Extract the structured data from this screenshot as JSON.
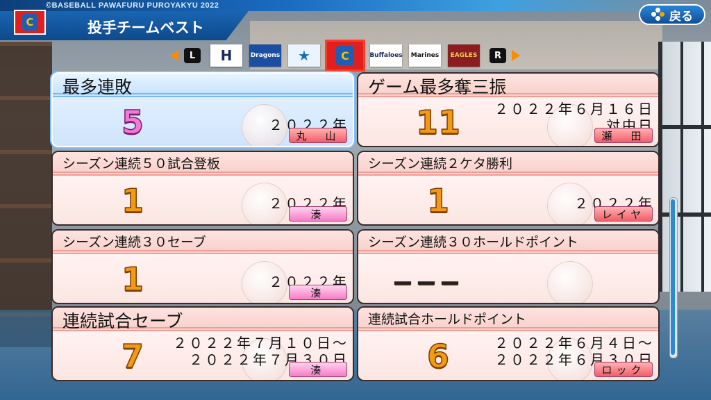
{
  "header": {
    "copyright": "©BASEBALL PAWAFURU PUROYAKYU 2022",
    "title": "投手チームベスト",
    "team_letter": "C",
    "back_label": "戻る"
  },
  "team_selector": {
    "left_key": "L",
    "right_key": "R",
    "teams": [
      {
        "mark": "H",
        "bg": "#ffffff",
        "fg": "#1a2a5a"
      },
      {
        "mark": "Dragons",
        "bg": "#1b4da0",
        "fg": "#ffffff"
      },
      {
        "mark": "★",
        "bg": "#eaf4ff",
        "fg": "#1a6bc0"
      },
      {
        "mark": "C",
        "bg": "#e0201f",
        "fg": "#f4c300",
        "selected": true
      },
      {
        "mark": "Buffaloes",
        "bg": "#ffffff",
        "fg": "#1a2a5a"
      },
      {
        "mark": "Marines",
        "bg": "#ffffff",
        "fg": "#111111"
      },
      {
        "mark": "EAGLES",
        "bg": "#8b1c22",
        "fg": "#f2c94c"
      }
    ]
  },
  "records": [
    {
      "label": "最多連敗",
      "value": "5",
      "dates": [
        "２０２２年"
      ],
      "player": "丸　山",
      "player_style": "red",
      "value_style": "pink",
      "style": "blue",
      "big": true
    },
    {
      "label": "ゲーム最多奪三振",
      "value": "11",
      "dates": [
        "２０２２年６月１６日",
        "対中日"
      ],
      "player": "瀬　田",
      "player_style": "red",
      "value_style": "orange",
      "style": "pink",
      "big": true
    },
    {
      "label": "シーズン連続５０試合登板",
      "value": "1",
      "dates": [
        "２０２２年"
      ],
      "player": "湊",
      "player_style": "pink",
      "value_style": "orange",
      "style": "pink"
    },
    {
      "label": "シーズン連続２ケタ勝利",
      "value": "1",
      "dates": [
        "２０２２年"
      ],
      "player": "レイヤ",
      "player_style": "red",
      "value_style": "orange",
      "style": "pink"
    },
    {
      "label": "シーズン連続３０セーブ",
      "value": "1",
      "dates": [
        "２０２２年"
      ],
      "player": "湊",
      "player_style": "pink",
      "value_style": "orange",
      "style": "pink"
    },
    {
      "label": "シーズン連続３０ホールドポイント",
      "value": "－－－",
      "dates": [],
      "player": "",
      "player_style": "none",
      "value_style": "dash",
      "style": "pink"
    },
    {
      "label": "連続試合セーブ",
      "value": "7",
      "dates": [
        "２０２２年７月１０日～",
        "２０２２年７月３０日"
      ],
      "player": "湊",
      "player_style": "pink",
      "value_style": "orange",
      "style": "pink",
      "big": true
    },
    {
      "label": "連続試合ホールドポイント",
      "value": "6",
      "dates": [
        "２０２２年６月４日～",
        "２０２２年６月３０日"
      ],
      "player": "ロック",
      "player_style": "red",
      "value_style": "orange",
      "style": "pink"
    }
  ]
}
